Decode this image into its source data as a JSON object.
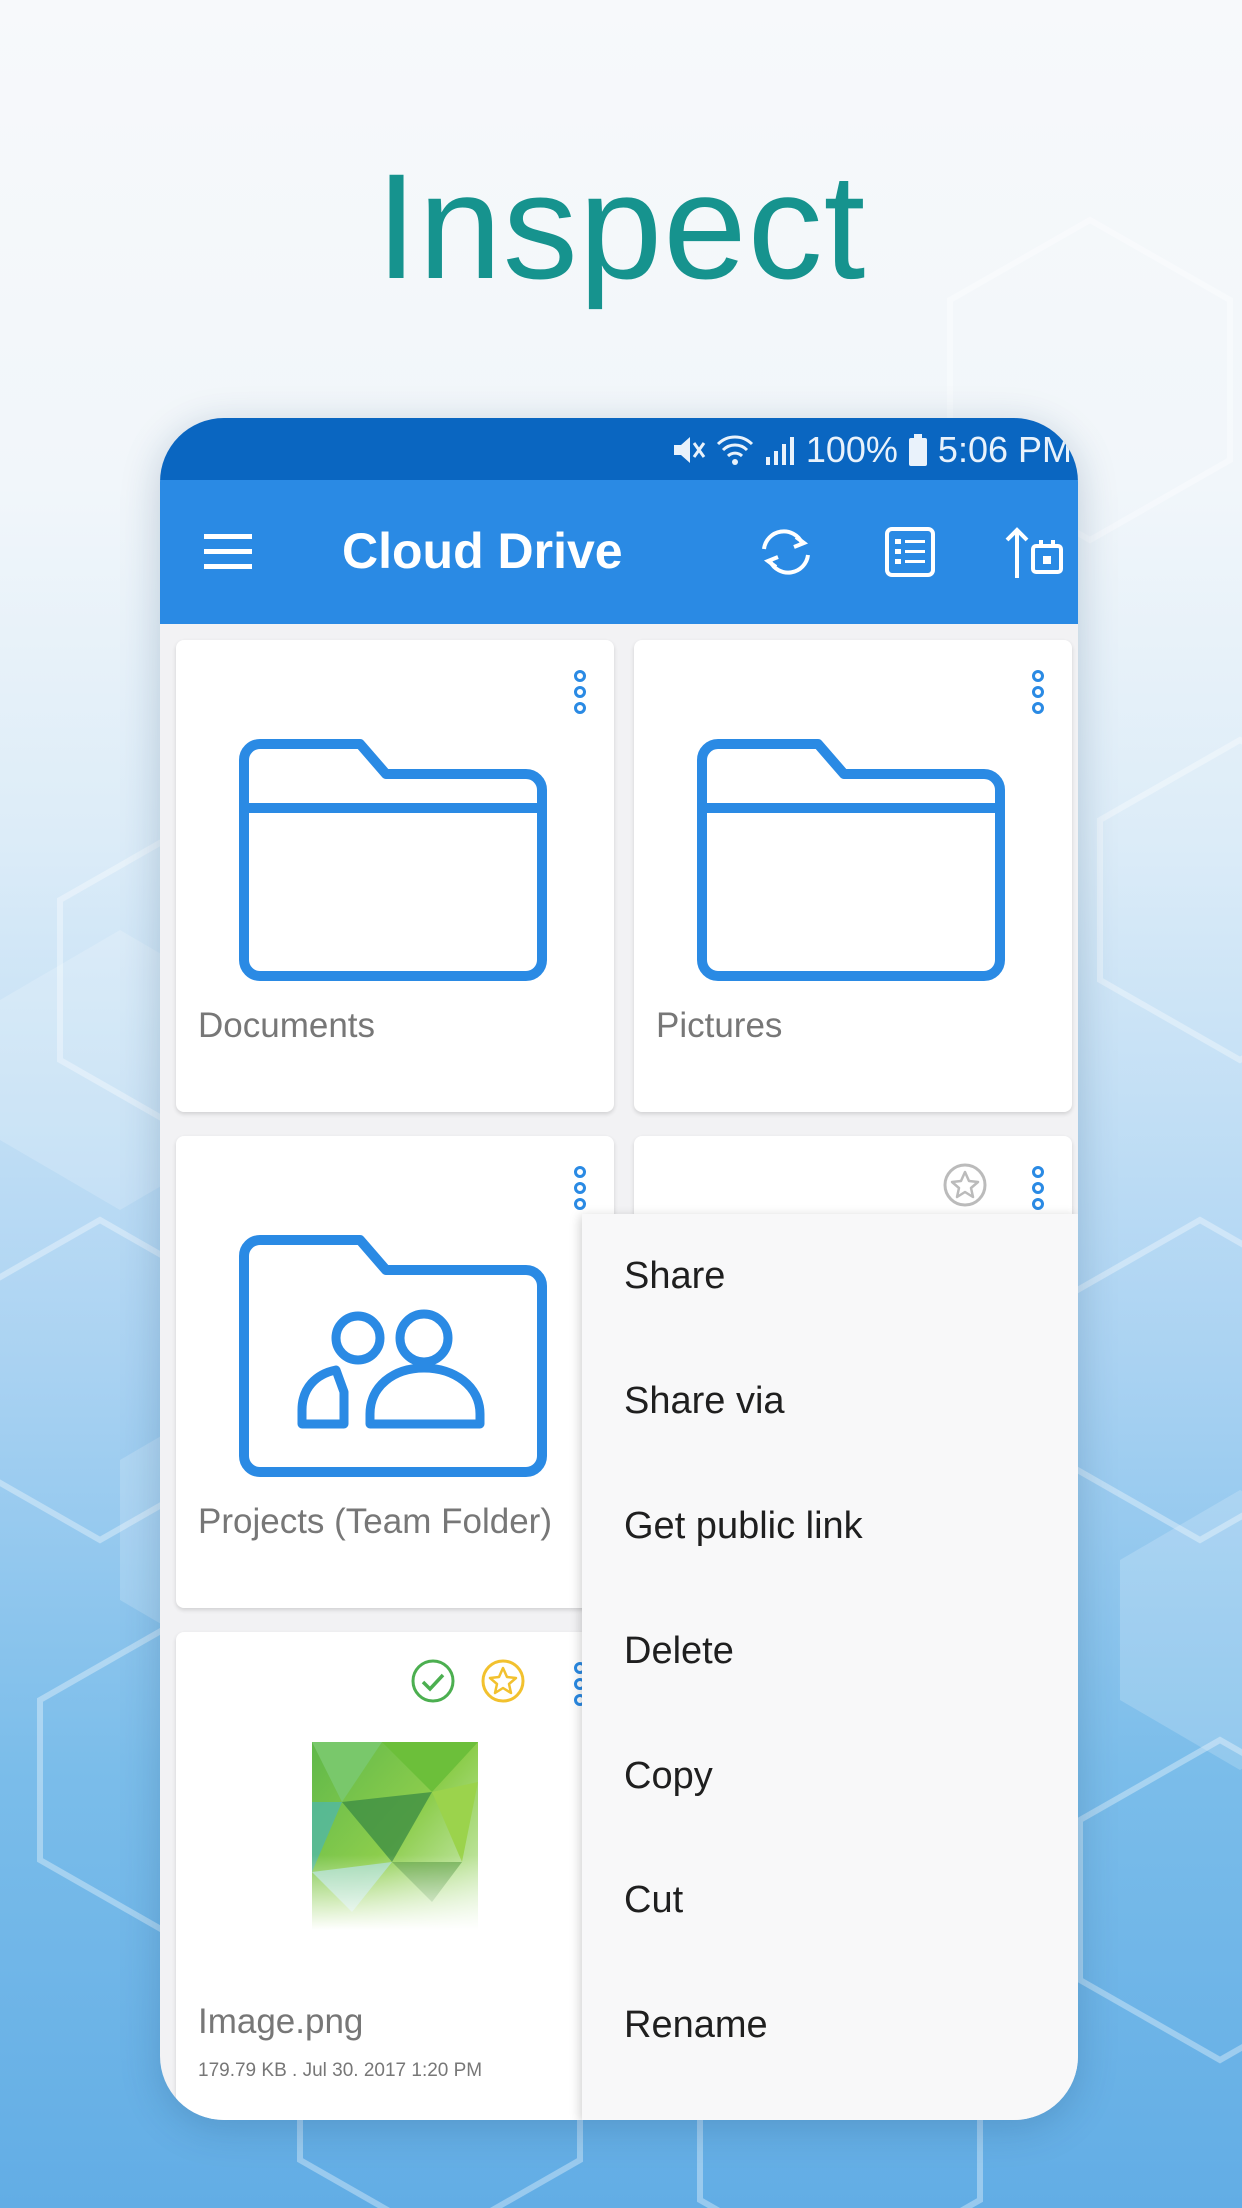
{
  "headline": "Inspect",
  "status_bar": {
    "battery": "100%",
    "time": "5:06 PM"
  },
  "toolbar": {
    "title": "Cloud Drive",
    "icons": [
      "menu-icon",
      "sync-icon",
      "list-view-icon",
      "upload-icon"
    ]
  },
  "items": [
    {
      "name": "Documents",
      "type": "folder"
    },
    {
      "name": "Pictures",
      "type": "folder"
    },
    {
      "name": "Projects (Team Folder)",
      "type": "team-folder"
    },
    {
      "name": "",
      "type": "file",
      "starred": false
    },
    {
      "name": "Image.png",
      "type": "image",
      "meta": "179.79 KB . Jul 30. 2017 1:20 PM",
      "synced": true,
      "starred": true
    }
  ],
  "context_menu": {
    "items": [
      "Share",
      "Share via",
      "Get public link",
      "Delete",
      "Copy",
      "Cut",
      "Rename"
    ]
  },
  "colors": {
    "accent": "#2a8ae4",
    "status_bar": "#0a66c1",
    "headline": "#16938e",
    "synced": "#4caf50",
    "star": "#f2c12e"
  }
}
